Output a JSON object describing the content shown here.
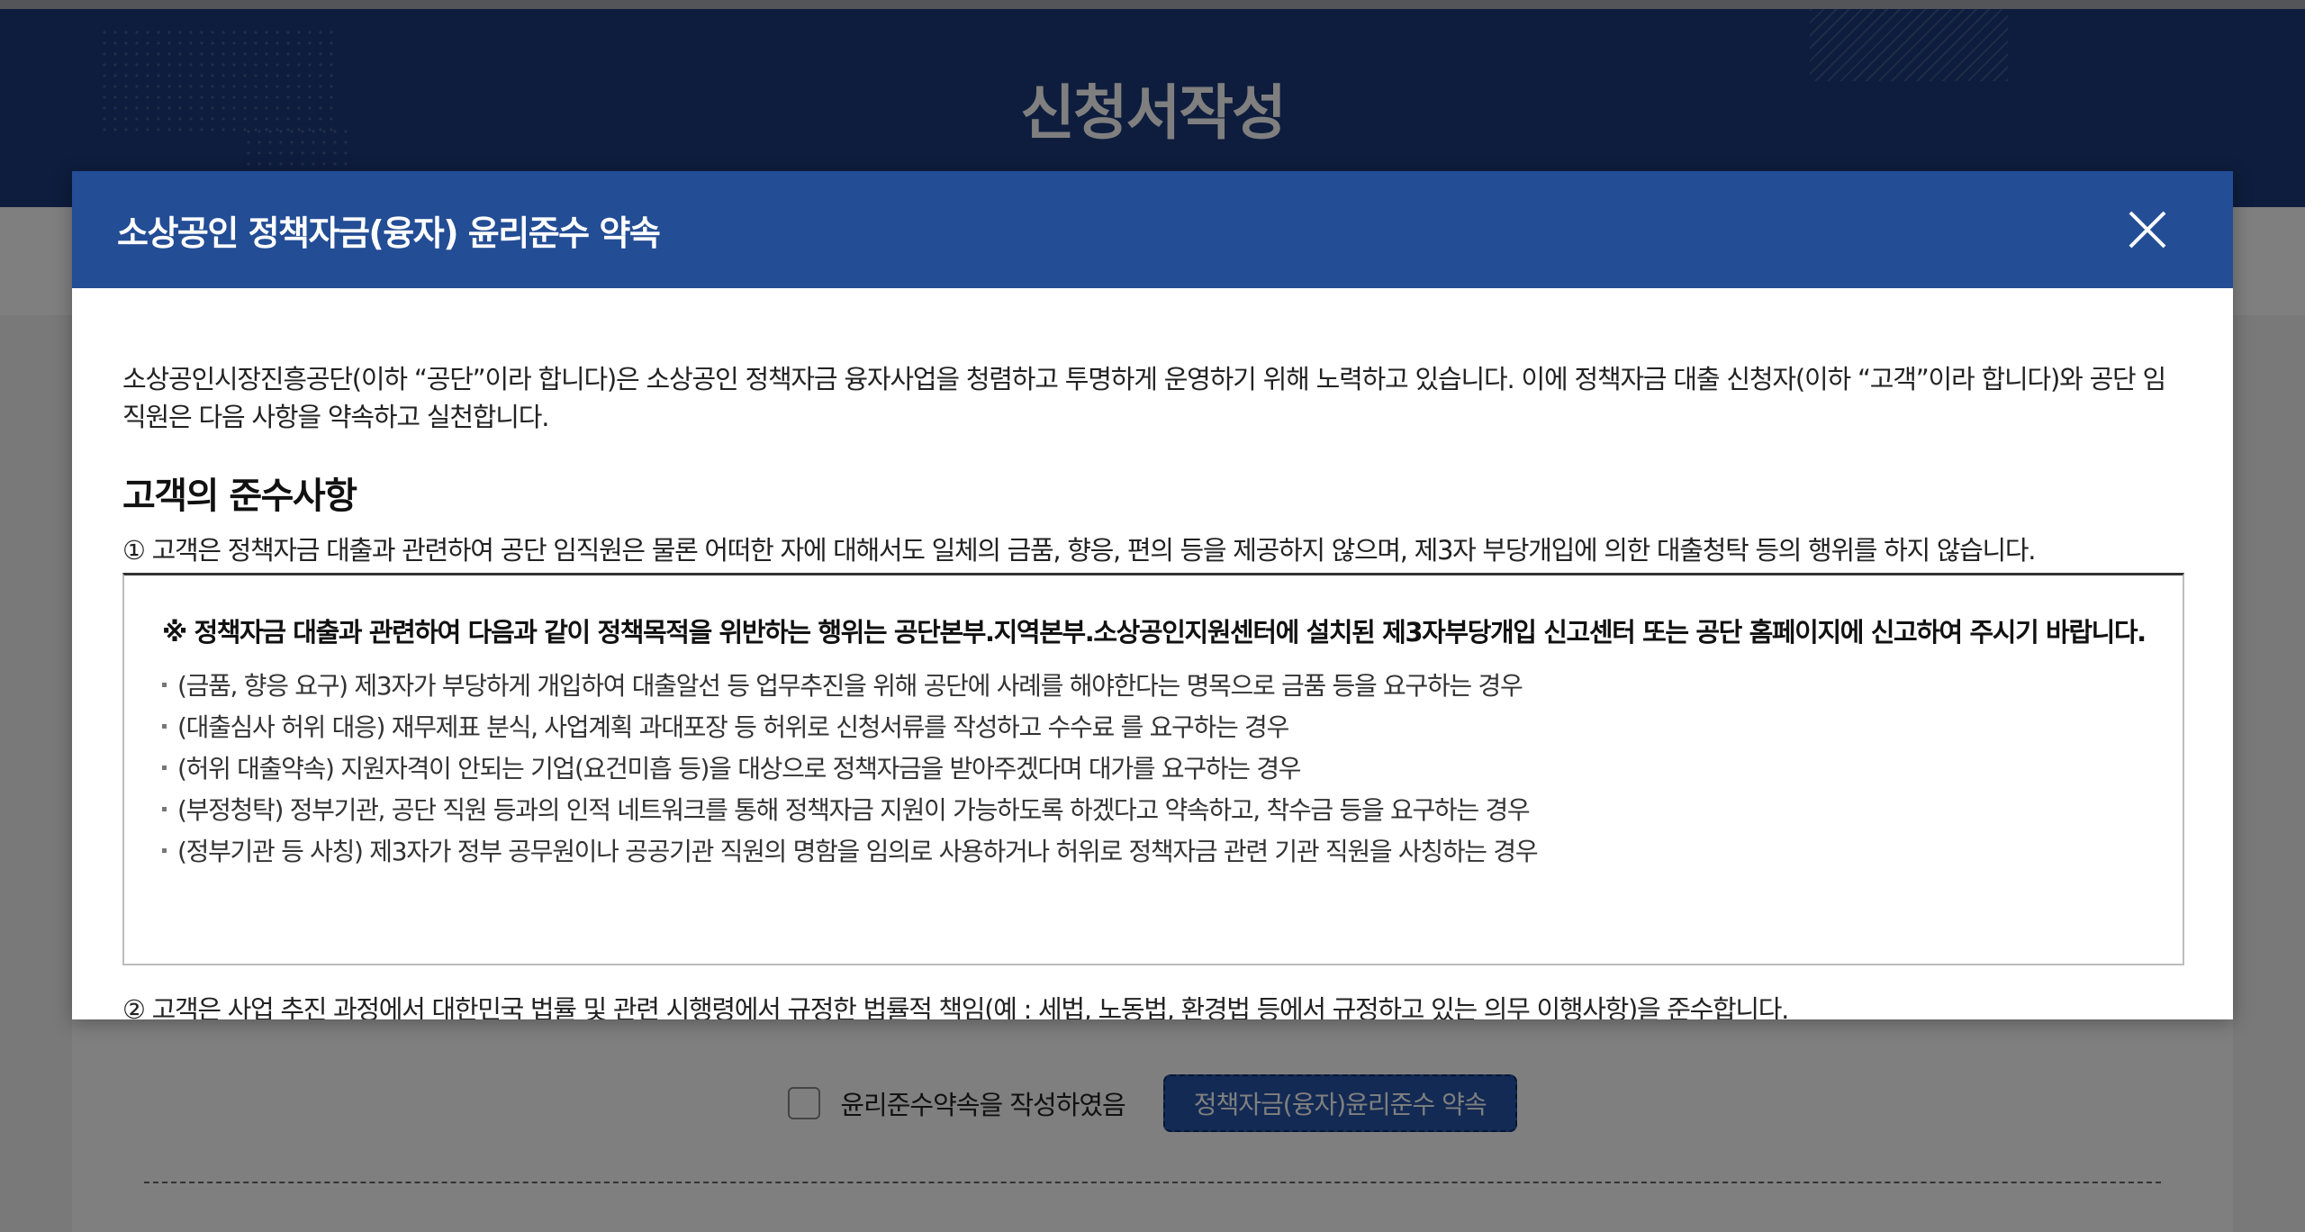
{
  "page": {
    "title": "신청서작성",
    "agree_label": "윤리준수약속을 작성하였음",
    "agree_button": "정책자금(융자)윤리준수 약속"
  },
  "modal": {
    "title": "소상공인 정책자금(융자) 윤리준수 약속",
    "intro": "소상공인시장진흥공단(이하 “공단”이라 합니다)은 소상공인 정책자금 융자사업을 청렴하고 투명하게 운영하기 위해 노력하고 있습니다. 이에 정책자금 대출 신청자(이하 “고객”이라 합니다)와 공단 임직원은 다음 사항을 약속하고 실천합니다.",
    "section_heading": "고객의 준수사항",
    "item1": "① 고객은 정책자금 대출과 관련하여 공단 임직원은 물론 어떠한 자에 대해서도 일체의 금품, 향응, 편의 등을 제공하지 않으며, 제3자 부당개입에 의한 대출청탁 등의 행위를 하지 않습니다.",
    "notice_title": "※ 정책자금 대출과 관련하여 다음과 같이 정책목적을 위반하는 행위는 공단본부.지역본부.소상공인지원센터에 설치된 제3자부당개입 신고센터 또는 공단 홈페이지에 신고하여 주시기 바랍니다.",
    "notice_items": [
      "(금품, 향응 요구) 제3자가 부당하게 개입하여 대출알선 등 업무추진을 위해 공단에 사례를 해야한다는 명목으로 금품 등을 요구하는 경우",
      "(대출심사 허위 대응) 재무제표 분식, 사업계획 과대포장 등 허위로 신청서류를 작성하고 수수료 를 요구하는 경우",
      "(허위 대출약속) 지원자격이 안되는 기업(요건미흡 등)을 대상으로 정책자금을 받아주겠다며 대가를 요구하는 경우",
      "(부정청탁) 정부기관, 공단 직원 등과의 인적 네트워크를 통해 정책자금 지원이 가능하도록 하겠다고 약속하고, 착수금 등을 요구하는 경우",
      "(정부기관 등 사칭) 제3자가 정부 공무원이나 공공기관 직원의 명함을 임의로 사용하거나 허위로 정책자금 관련 기관 직원을 사칭하는 경우"
    ],
    "item2": "② 고객은 사업 추진 과정에서 대한민국 법률 및 관련 시행령에서 규정한 법률적 책임(예 : 세법, 노동법, 환경법 등에서 규정하고 있는 의무 이행사항)을 준수합니다.",
    "close_icon": "close-icon"
  }
}
